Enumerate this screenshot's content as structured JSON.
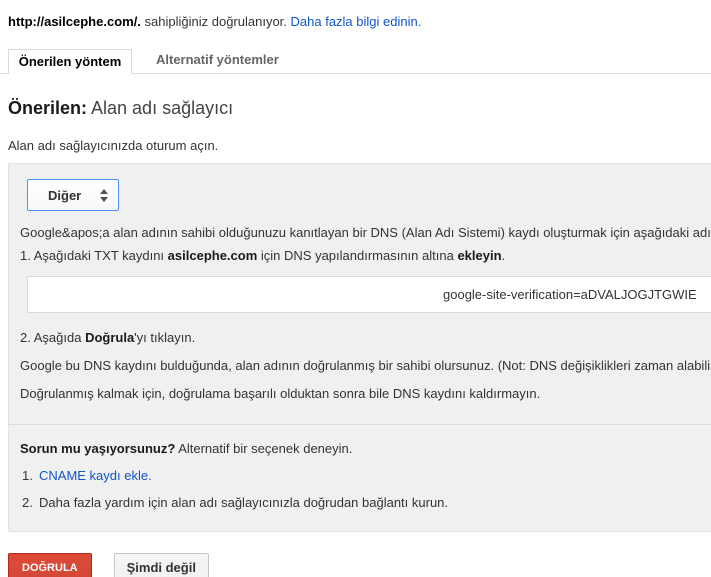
{
  "verify_status": {
    "url": "http://asilcephe.com/.",
    "text": " sahipliğiniz doğrulanıyor. ",
    "link": "Daha fazla bilgi edinin."
  },
  "tabs": {
    "recommended": "Önerilen yöntem",
    "alternative": "Alternatif yöntemler"
  },
  "heading": {
    "prefix": "Önerilen:",
    "method": " Alan adı sağlayıcı"
  },
  "login_note": "Alan adı sağlayıcınızda oturum açın.",
  "panel": {
    "provider_select_value": "Diğer",
    "intro": "Google&apos;a alan adının sahibi olduğunuzu kanıtlayan bir DNS (Alan Adı Sistemi) kaydı oluşturmak için aşağıdaki adımları izleyin.",
    "step1": {
      "pre": "1. Aşağıdaki TXT kaydını ",
      "domain": "asilcephe.com",
      "mid": " için DNS yapılandırmasının altına ",
      "bold": "ekleyin",
      "post": "."
    },
    "txt_record": "google-site-verification=aDVALJOGJTGWIE",
    "step2": {
      "pre": "2. Aşağıda ",
      "bold": "Doğrula",
      "post": "'yı tıklayın."
    },
    "note_found": "Google bu DNS kaydını bulduğunda, alan adının doğrulanmış bir sahibi olursunuz. (Not: DNS değişiklikleri zaman alabilir. Kaydı hemen bulamazsak, düzenli aralıklarla kontrol ederiz.)",
    "note_keep": "Doğrulanmış kalmak için, doğrulama başarılı olduktan sonra bile DNS kaydını kaldırmayın.",
    "trouble": {
      "bold": "Sorun mu yaşıyorsunuz?",
      "rest": " Alternatif bir seçenek deneyin."
    },
    "alternatives": [
      {
        "num": "1.",
        "label": "CNAME kaydı ekle."
      },
      {
        "num": "2.",
        "label": "Daha fazla yardım için alan adı sağlayıcınızla doğrudan bağlantı kurun."
      }
    ]
  },
  "buttons": {
    "verify": "DOĞRULA",
    "not_now": "Şimdi değil"
  },
  "colors": {
    "accent_red": "#d14836",
    "link_blue": "#1155cc",
    "focus_blue": "#4d90fe",
    "panel_gray": "#f0f0f0"
  }
}
